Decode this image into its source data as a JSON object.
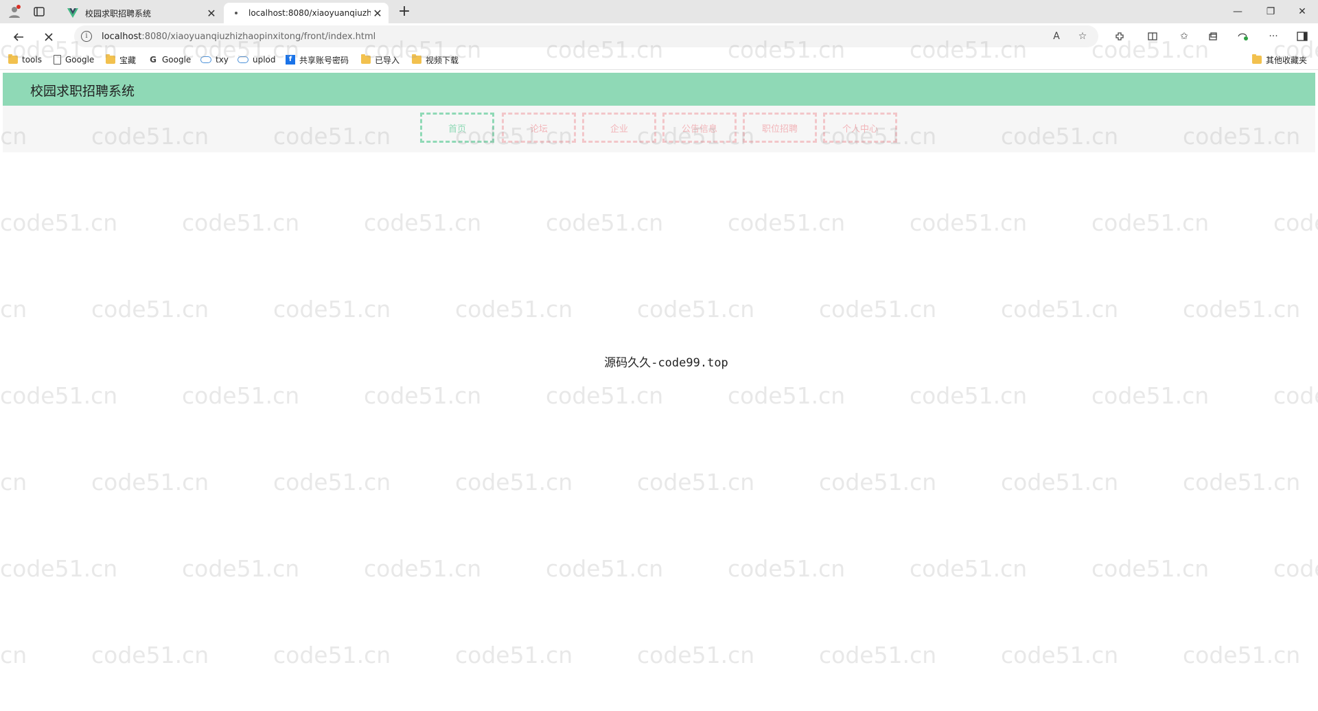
{
  "browser": {
    "tabs": [
      {
        "title": "校园求职招聘系统",
        "favicon": "vue-logo-icon",
        "active": false
      },
      {
        "title": "localhost:8080/xiaoyuanqiuzhizh",
        "favicon": "loading-dot-icon",
        "active": true
      }
    ],
    "new_tab_label": "+",
    "window_controls": {
      "minimize": "—",
      "restore": "❐",
      "close": "✕"
    },
    "address": {
      "host": "localhost",
      "path": ":8080/xiaoyuanqiuzhizhaopinxitong/front/index.html"
    },
    "bookmarks": [
      {
        "label": "tools",
        "icon": "folder-icon"
      },
      {
        "label": "Google",
        "icon": "page-icon"
      },
      {
        "label": "宝藏",
        "icon": "folder-icon"
      },
      {
        "label": "Google",
        "icon": "google-icon"
      },
      {
        "label": "txy",
        "icon": "cloud-icon"
      },
      {
        "label": "uplod",
        "icon": "cloud-icon"
      },
      {
        "label": "共享账号密码",
        "icon": "feishu-icon"
      },
      {
        "label": "已导入",
        "icon": "folder-icon"
      },
      {
        "label": "视频下载",
        "icon": "folder-icon"
      }
    ],
    "other_bookmarks": "其他收藏夹"
  },
  "site": {
    "title": "校园求职招聘系统",
    "nav": [
      "首页",
      "论坛",
      "企业",
      "公告信息",
      "职位招聘",
      "个人中心"
    ],
    "active_nav_index": 0,
    "center_text": "源码久久-code99.top",
    "watermark": "code51.cn"
  },
  "colors": {
    "header": "#8fd9b6",
    "nav_active": "#8fd9b6",
    "nav_inactive": "#f2c6c9"
  }
}
